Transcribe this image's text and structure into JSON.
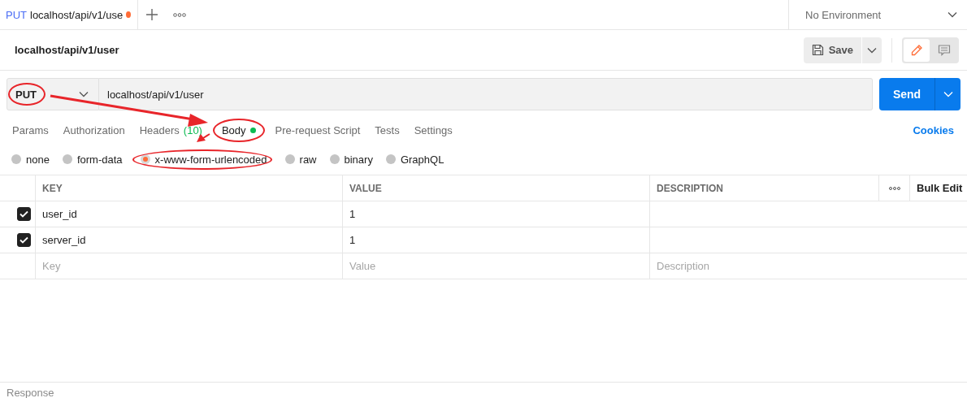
{
  "tabs": [
    {
      "method": "PUT",
      "title": "localhost/api/v1/use",
      "unsaved": true
    }
  ],
  "environment": {
    "value": "No Environment"
  },
  "request": {
    "name": "localhost/api/v1/user",
    "save_label": "Save",
    "modes": [
      {
        "kind": "edit",
        "selected": true
      },
      {
        "kind": "comment",
        "selected": false
      }
    ]
  },
  "url_bar": {
    "method": "PUT",
    "method_highlighted": true,
    "url": "localhost/api/v1/user",
    "send_label": "Send"
  },
  "request_tabs": [
    {
      "label": "Params",
      "selected": false,
      "highlighted": false
    },
    {
      "label": "Authorization",
      "selected": false,
      "highlighted": false
    },
    {
      "label": "Headers",
      "count": "(10)",
      "selected": false,
      "highlighted": false
    },
    {
      "label": "Body",
      "selected": true,
      "has_content": true,
      "highlighted": true
    },
    {
      "label": "Pre-request Script",
      "selected": false,
      "highlighted": false
    },
    {
      "label": "Tests",
      "selected": false,
      "highlighted": false
    },
    {
      "label": "Settings",
      "selected": false,
      "highlighted": false
    }
  ],
  "cookies": "Cookies",
  "body_types": [
    {
      "label": "none",
      "selected": false,
      "highlighted": false
    },
    {
      "label": "form-data",
      "selected": false,
      "highlighted": false
    },
    {
      "label": "x-www-form-urlencoded",
      "selected": true,
      "highlighted": true
    },
    {
      "label": "raw",
      "selected": false,
      "highlighted": false
    },
    {
      "label": "binary",
      "selected": false,
      "highlighted": false
    },
    {
      "label": "GraphQL",
      "selected": false,
      "highlighted": false
    }
  ],
  "table": {
    "columns": [
      "KEY",
      "VALUE",
      "DESCRIPTION"
    ],
    "bulk_edit": "Bulk Edit",
    "rows": [
      {
        "checked": true,
        "key": "user_id",
        "value": "1"
      },
      {
        "checked": true,
        "key": "server_id",
        "value": "1"
      }
    ],
    "placeholder_row": {
      "key": "Key",
      "value": "Value",
      "description": "Description"
    }
  },
  "response": {
    "title": "Response"
  }
}
